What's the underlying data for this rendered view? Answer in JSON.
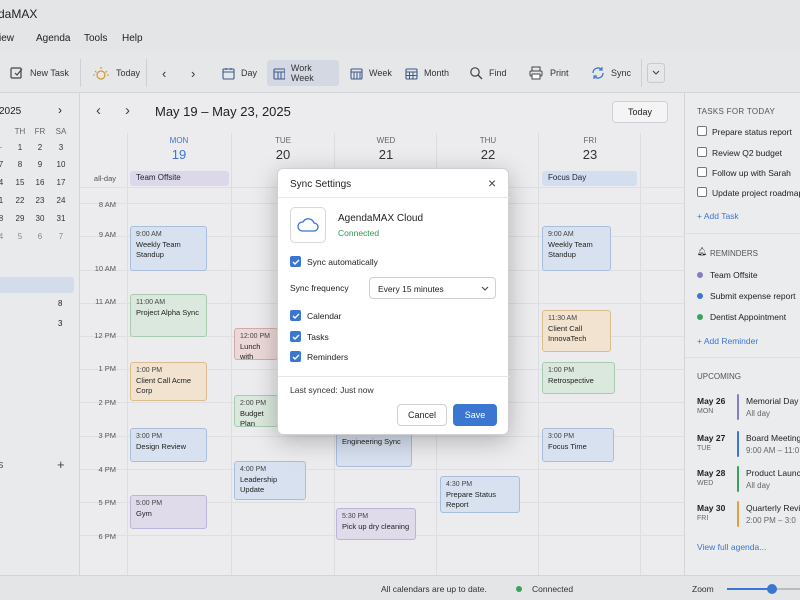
{
  "app": {
    "title": "daMAX"
  },
  "menu": [
    "View",
    "Agenda",
    "Tools",
    "Help"
  ],
  "menu_view": "iew",
  "toolbar": {
    "new_task": "New Task",
    "today": "Today",
    "day": "Day",
    "work_week": "Work Week",
    "week": "Week",
    "month": "Month",
    "find": "Find",
    "print": "Print",
    "sync": "Sync"
  },
  "mini_cal": {
    "year": "2025",
    "days": [
      "FR",
      "SA"
    ],
    "days_more": [
      "TH"
    ],
    "rows": [
      [
        "1",
        "2",
        "3"
      ],
      [
        "8",
        "9",
        "10"
      ],
      [
        "15",
        "16",
        "17"
      ],
      [
        "22",
        "23",
        "24"
      ],
      [
        "29",
        "30",
        "31"
      ],
      [
        "5",
        "6",
        "7"
      ]
    ],
    "lead": [
      "",
      "",
      "4",
      "1",
      "8"
    ],
    "extra1": "8",
    "extra2": "3",
    "section": "S"
  },
  "calendar": {
    "range": "May 19 – May 23, 2025",
    "today_btn": "Today",
    "days": [
      {
        "dow": "MON",
        "num": "19"
      },
      {
        "dow": "TUE",
        "num": "20"
      },
      {
        "dow": "WED",
        "num": "21"
      },
      {
        "dow": "THU",
        "num": "22"
      },
      {
        "dow": "FRI",
        "num": "23"
      }
    ],
    "allday_label": "all-day",
    "allday_mon": "Team Offsite",
    "allday_fri": "Focus Day",
    "times": [
      "8 AM",
      "9 AM",
      "10 AM",
      "11 AM",
      "12 PM",
      "1 PM",
      "2 PM",
      "3 PM",
      "4 PM",
      "5 PM",
      "6 PM"
    ],
    "events": {
      "mon1": {
        "time": "9:00 AM",
        "title": "Weekly Team Standup"
      },
      "mon2": {
        "time": "11:00 AM",
        "title": "Project Alpha Sync"
      },
      "mon3": {
        "time": "1:00 PM",
        "title": "Client Call Acme Corp"
      },
      "mon4": {
        "time": "3:00 PM",
        "title": "Design Review"
      },
      "mon5": {
        "time": "5:00 PM",
        "title": "Gym"
      },
      "tue1": {
        "time": "12:00 PM",
        "title": "Lunch with"
      },
      "tue2": {
        "time": "2:00 PM",
        "title": "Budget Plan"
      },
      "tue3": {
        "time": "4:00 PM",
        "title": "Leadership Update"
      },
      "wed1": {
        "time": "3:00 PM",
        "title": "Engineering Sync"
      },
      "wed2": {
        "time": "5:30 PM",
        "title": "Pick up dry cleaning"
      },
      "thu1": {
        "time": "4:30 PM",
        "title": "Prepare Status Report"
      },
      "fri1": {
        "time": "9:00 AM",
        "title": "Weekly Team Standup"
      },
      "fri2": {
        "time": "11:30 AM",
        "title": "Client Call InnovaTech"
      },
      "fri3": {
        "time": "1:00 PM",
        "title": "Retrospective"
      },
      "fri4": {
        "time": "3:00 PM",
        "title": "Focus Time"
      }
    }
  },
  "dialog": {
    "title": "Sync Settings",
    "service": "AgendaMAX Cloud",
    "status": "Connected",
    "sync_auto": "Sync automatically",
    "freq_label": "Sync frequency",
    "freq_value": "Every 15 minutes",
    "opt_calendar": "Calendar",
    "opt_tasks": "Tasks",
    "opt_reminders": "Reminders",
    "last_synced": "Last synced: Just now",
    "cancel": "Cancel",
    "save": "Save"
  },
  "tasks": {
    "header": "TASKS FOR TODAY",
    "items": [
      "Prepare status report",
      "Review Q2 budget",
      "Follow up with Sarah",
      "Update project roadmap"
    ],
    "add": "+ Add Task"
  },
  "reminders": {
    "header": "REMINDERS",
    "items": [
      {
        "label": "Team Offsite",
        "color": "#8a78c8"
      },
      {
        "label": "Submit expense report",
        "color": "#3b76d1"
      },
      {
        "label": "Dentist Appointment",
        "color": "#3aa35a"
      }
    ],
    "add": "+ Add Reminder"
  },
  "upcoming": {
    "header": "UPCOMING",
    "items": [
      {
        "date": "May 26",
        "dow": "MON",
        "title": "Memorial Day",
        "sub": "All day",
        "color": "#8a78c8"
      },
      {
        "date": "May 27",
        "dow": "TUE",
        "title": "Board Meeting",
        "sub": "9:00 AM – 11:0",
        "color": "#3b76d1"
      },
      {
        "date": "May 28",
        "dow": "WED",
        "title": "Product Launch",
        "sub": "All day",
        "color": "#3aa35a"
      },
      {
        "date": "May 30",
        "dow": "FRI",
        "title": "Quarterly Review",
        "sub": "2:00 PM – 3:0",
        "color": "#e0a040"
      }
    ],
    "view_full": "View full agenda..."
  },
  "status": {
    "message": "All calendars are up to date.",
    "conn": "Connected",
    "zoom": "Zoom",
    "conn_color": "#3aa35a"
  }
}
